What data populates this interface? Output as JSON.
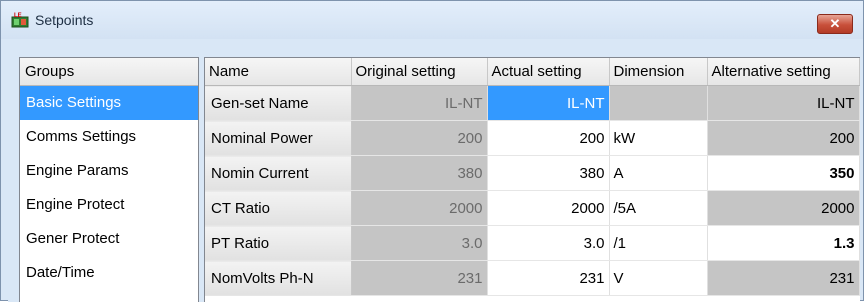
{
  "window": {
    "title": "Setpoints",
    "close_label": "✕"
  },
  "groups": {
    "header": "Groups",
    "items": [
      {
        "label": "Basic Settings",
        "selected": true
      },
      {
        "label": "Comms Settings"
      },
      {
        "label": "Engine Params"
      },
      {
        "label": "Engine Protect"
      },
      {
        "label": "Gener Protect"
      },
      {
        "label": "Date/Time"
      }
    ]
  },
  "table": {
    "columns": [
      "Name",
      "Original setting",
      "Actual setting",
      "Dimension",
      "Alternative setting"
    ],
    "rows": [
      {
        "name": "Gen-set Name",
        "original": "IL-NT",
        "actual": "IL-NT",
        "dimension": "",
        "alternative": "IL-NT",
        "selected": true,
        "alt_edited": false
      },
      {
        "name": "Nominal Power",
        "original": "200",
        "actual": "200",
        "dimension": "kW",
        "alternative": "200",
        "alt_edited": false
      },
      {
        "name": "Nomin Current",
        "original": "380",
        "actual": "380",
        "dimension": "A",
        "alternative": "350",
        "alt_edited": true
      },
      {
        "name": "CT Ratio",
        "original": "2000",
        "actual": "2000",
        "dimension": "/5A",
        "alternative": "2000",
        "alt_edited": false
      },
      {
        "name": "PT Ratio",
        "original": "3.0",
        "actual": "3.0",
        "dimension": "/1",
        "alternative": "1.3",
        "alt_edited": true
      },
      {
        "name": "NomVolts Ph-N",
        "original": "231",
        "actual": "231",
        "dimension": "V",
        "alternative": "231",
        "alt_edited": false
      }
    ]
  }
}
